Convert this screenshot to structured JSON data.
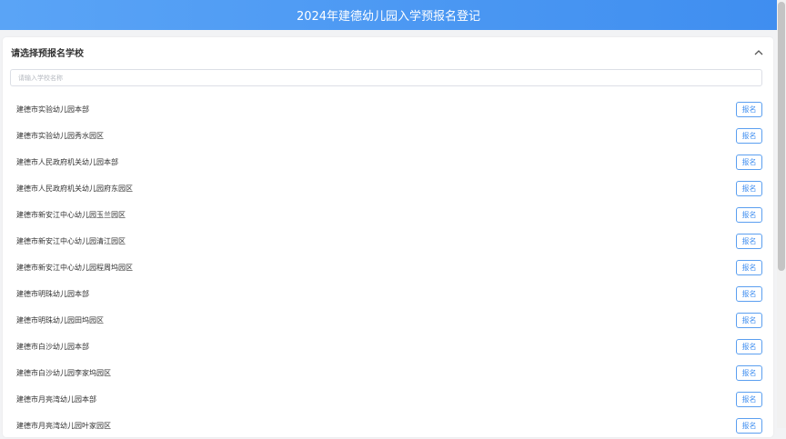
{
  "header": {
    "title": "2024年建德幼儿园入学预报名登记"
  },
  "panel": {
    "title": "请选择预报名学校",
    "collapse_icon": "chevron-up-icon",
    "search": {
      "placeholder": "请输入学校名称",
      "value": ""
    }
  },
  "schools": [
    {
      "name": "建德市实验幼儿园本部",
      "action": "报名"
    },
    {
      "name": "建德市实验幼儿园秀水园区",
      "action": "报名"
    },
    {
      "name": "建德市人民政府机关幼儿园本部",
      "action": "报名"
    },
    {
      "name": "建德市人民政府机关幼儿园府东园区",
      "action": "报名"
    },
    {
      "name": "建德市新安江中心幼儿园玉兰园区",
      "action": "报名"
    },
    {
      "name": "建德市新安江中心幼儿园清江园区",
      "action": "报名"
    },
    {
      "name": "建德市新安江中心幼儿园程周坞园区",
      "action": "报名"
    },
    {
      "name": "建德市明珠幼儿园本部",
      "action": "报名"
    },
    {
      "name": "建德市明珠幼儿园田坞园区",
      "action": "报名"
    },
    {
      "name": "建德市白沙幼儿园本部",
      "action": "报名"
    },
    {
      "name": "建德市白沙幼儿园李家坞园区",
      "action": "报名"
    },
    {
      "name": "建德市月亮湾幼儿园本部",
      "action": "报名"
    },
    {
      "name": "建德市月亮湾幼儿园叶家园区",
      "action": "报名"
    }
  ],
  "colors": {
    "header_start": "#5aa4f6",
    "header_end": "#3f8ef0",
    "accent": "#3f8ef0",
    "background": "#f2f3f5"
  }
}
